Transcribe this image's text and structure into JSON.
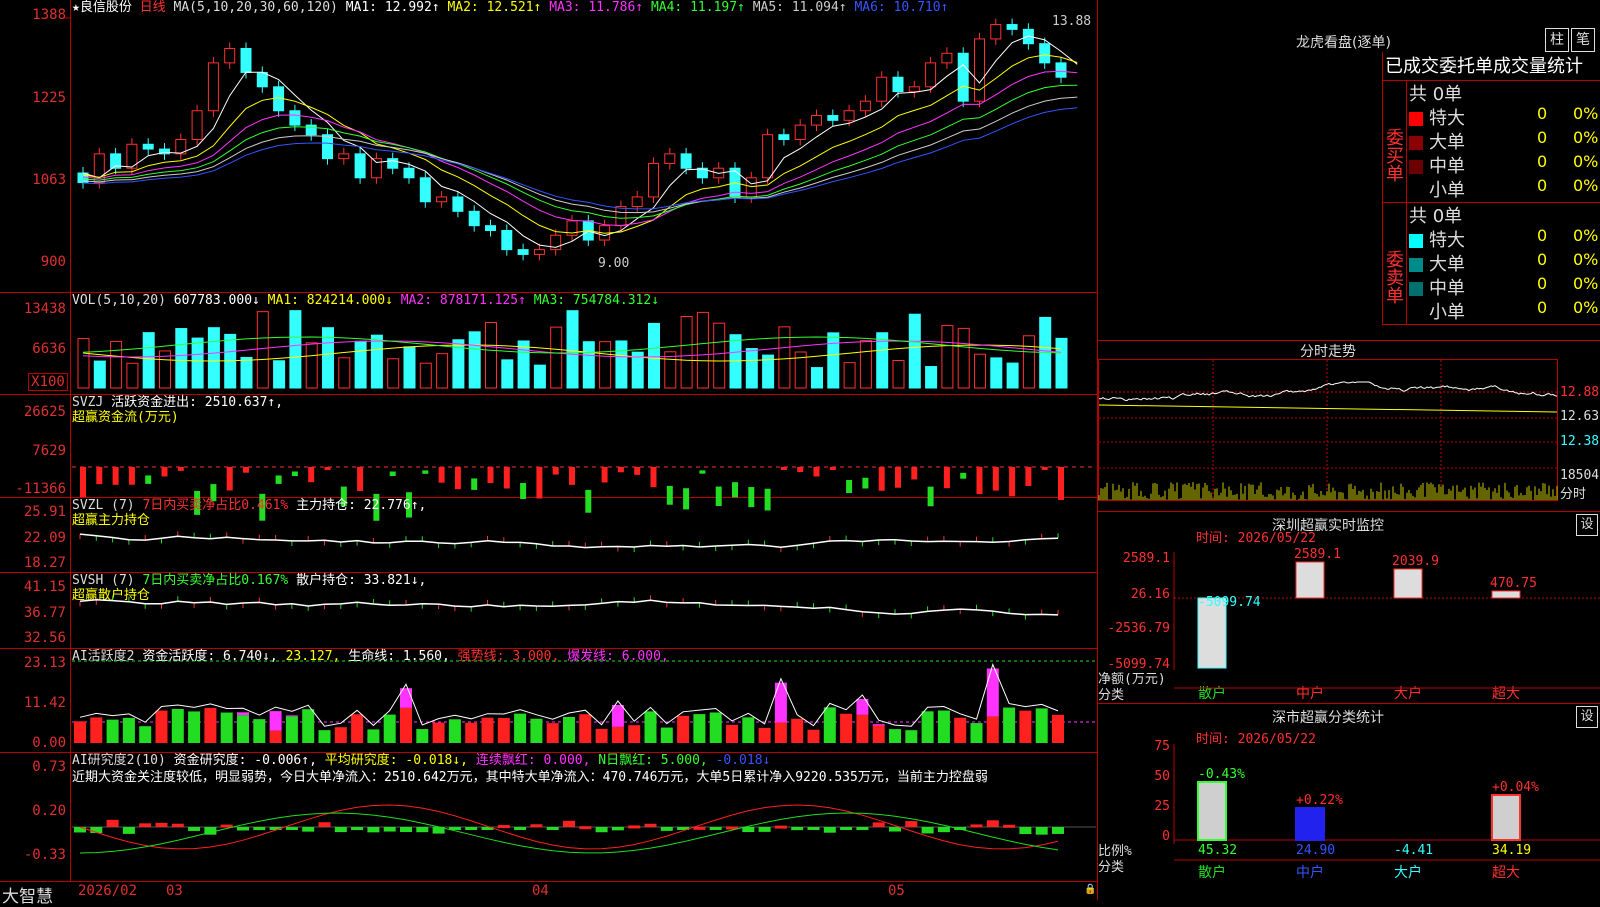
{
  "stock": {
    "name": "★良信股份",
    "period": "日线"
  },
  "ma_header": {
    "label": "MA(5,10,20,30,60,120)",
    "ma1": "MA1: 12.992↑",
    "ma2": "MA2: 12.521↑",
    "ma3": "MA3: 11.786↑",
    "ma4": "MA4: 11.197↑",
    "ma5": "MA5: 11.094↑",
    "ma6": "MA6: 10.710↑"
  },
  "price_axis": [
    "1388",
    "1225",
    "1063",
    "900"
  ],
  "price_marks": {
    "high": "13.88",
    "low": "9.00"
  },
  "vol": {
    "label": "VOL(5,10,20)",
    "value": "607783.000↓",
    "ma1": "MA1: 824214.000↓",
    "ma2": "MA2: 878171.125↑",
    "ma3": "MA3: 754784.312↓",
    "axis": [
      "13438",
      "6636"
    ],
    "unit": "X100"
  },
  "svzj": {
    "label": "SVZJ",
    "text": "活跃资金进出: 2510.637↑,",
    "sub": "超赢资金流(万元)",
    "axis": [
      "26625",
      "7629",
      "-11366"
    ]
  },
  "svzl": {
    "label": "SVZL (7)",
    "pct": "7日内买卖净占比0.461%",
    "main": "主力持仓: 22.776↑,",
    "sub": "超赢主力持仓",
    "axis": [
      "25.91",
      "22.09",
      "18.27"
    ]
  },
  "svsh": {
    "label": "SVSH (7)",
    "pct": "7日内买卖净占比0.167%",
    "retail": "散户持仓: 33.821↓,",
    "sub": "超赢散户持仓",
    "axis": [
      "41.15",
      "36.77",
      "32.56"
    ]
  },
  "ai1": {
    "label": "AI活跃度2",
    "a": "资金活跃度: 6.740↓,",
    "b": "23.127,",
    "c": "生命线: 1.560,",
    "d": "强势线: 3.000,",
    "e": "爆发线: 6.000,",
    "axis": [
      "23.13",
      "11.42",
      "0.00"
    ]
  },
  "ai2": {
    "label": "AI研究度2(10)",
    "a": "资金研究度: -0.006↑,",
    "b": "平均研究度: -0.018↓,",
    "c": "连续飘红: 0.000,",
    "d": "N日飘红: 5.000,",
    "e": "-0.018↓",
    "axis": [
      "0.73",
      "0.20",
      "-0.33"
    ],
    "comment": "近期大资金关注度较低，明显弱势，今日大单净流入：2510.642万元，其中特大单净流入：470.746万元，大单5日累计净入9220.535万元，当前主力控盘弱"
  },
  "bottom": {
    "brand": "大智慧",
    "dates": [
      "2026/02",
      "03",
      "04",
      "05"
    ]
  },
  "lhb": {
    "title": "龙虎看盘(逐单)",
    "btn1": "柱",
    "btn2": "笔",
    "tabs": "已成交委托单成交量统计",
    "buy": {
      "side": "委买单",
      "count": "共 0单",
      "rows": [
        {
          "label": "特大",
          "v": "0",
          "p": "0%",
          "color": "#ff0000"
        },
        {
          "label": "大单",
          "v": "0",
          "p": "0%",
          "color": "#8b0000"
        },
        {
          "label": "中单",
          "v": "0",
          "p": "0%",
          "color": "#6b0000"
        },
        {
          "label": "小单",
          "v": "0",
          "p": "0%",
          "color": ""
        }
      ]
    },
    "sell": {
      "side": "委卖单",
      "count": "共 0单",
      "rows": [
        {
          "label": "特大",
          "v": "0",
          "p": "0%",
          "color": "#00ffff"
        },
        {
          "label": "大单",
          "v": "0",
          "p": "0%",
          "color": "#008b8b"
        },
        {
          "label": "中单",
          "v": "0",
          "p": "0%",
          "color": "#007070"
        },
        {
          "label": "小单",
          "v": "0",
          "p": "0%",
          "color": ""
        }
      ]
    }
  },
  "fenshi": {
    "title": "分时走势",
    "axis": [
      "12.88",
      "12.63",
      "12.38",
      "18504",
      "分时"
    ]
  },
  "monitor": {
    "title": "深圳超赢实时监控",
    "btn": "设",
    "time": "时间: 2026/05/22",
    "axis": [
      "2589.1",
      "26.16",
      "-2536.79",
      "-5099.74"
    ],
    "unit": "净额(万元)",
    "cat_label": "分类",
    "bars": [
      {
        "name": "散户",
        "value": "-5099.74"
      },
      {
        "name": "中户",
        "value": "2589.1"
      },
      {
        "name": "大户",
        "value": "2039.9"
      },
      {
        "name": "超大",
        "value": "470.75"
      }
    ]
  },
  "classify": {
    "title": "深市超赢分类统计",
    "btn": "设",
    "time": "时间: 2026/05/22",
    "axis": [
      "75",
      "50",
      "25",
      "0"
    ],
    "unit": "比例%",
    "cat_label": "分类",
    "bars": [
      {
        "name": "散户",
        "value": "45.32",
        "chg": "-0.43%"
      },
      {
        "name": "中户",
        "value": "24.90",
        "chg": "+0.22%"
      },
      {
        "name": "大户",
        "value": "-4.41",
        "chg": ""
      },
      {
        "name": "超大",
        "value": "34.19",
        "chg": "+0.04%"
      }
    ]
  }
}
